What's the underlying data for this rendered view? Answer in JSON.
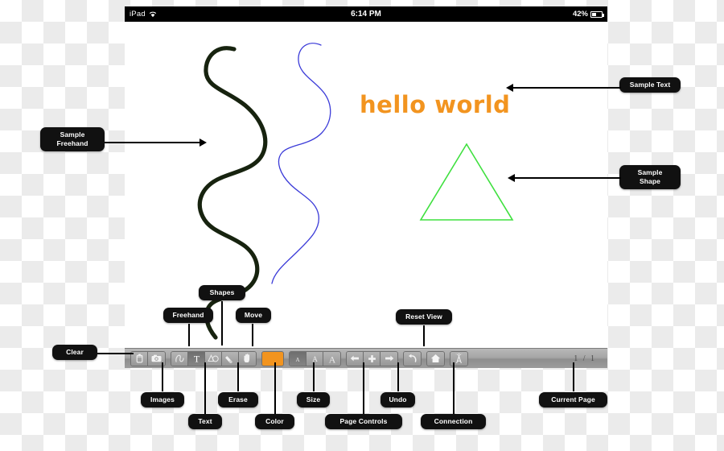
{
  "device": {
    "status_bar": {
      "device_name": "iPad",
      "wifi_icon": "wifi-icon",
      "time": "6:14 PM",
      "battery_percent": "42%",
      "battery_icon": "battery-icon"
    }
  },
  "canvas": {
    "text_object": "hello world",
    "text_color": "#f2941f",
    "freehand_stroke_1_color": "#17230f",
    "freehand_stroke_2_color": "#3b3bd8",
    "shape": "triangle",
    "shape_color": "#3fe03f"
  },
  "toolbar": {
    "groups": [
      {
        "name": "file-group",
        "buttons": [
          {
            "name": "clear-button",
            "icon": "trash-icon",
            "selected": false
          },
          {
            "name": "images-button",
            "icon": "camera-icon",
            "selected": false
          }
        ]
      },
      {
        "name": "tools-group",
        "buttons": [
          {
            "name": "freehand-tool",
            "icon": "squiggle-icon",
            "selected": false
          },
          {
            "name": "text-tool",
            "icon": "text-T-icon",
            "selected": true
          },
          {
            "name": "shapes-tool",
            "icon": "shapes-icon",
            "selected": false
          },
          {
            "name": "erase-tool",
            "icon": "eraser-icon",
            "selected": false
          },
          {
            "name": "move-tool",
            "icon": "hand-icon",
            "selected": false
          }
        ]
      },
      {
        "name": "size-group",
        "buttons": [
          {
            "name": "size-small",
            "icon": "A-small-icon",
            "selected": true
          },
          {
            "name": "size-medium",
            "icon": "A-medium-icon",
            "selected": false
          },
          {
            "name": "size-large",
            "icon": "A-large-icon",
            "selected": false
          }
        ]
      },
      {
        "name": "page-controls-group",
        "buttons": [
          {
            "name": "page-previous",
            "icon": "arrow-left-icon",
            "selected": false
          },
          {
            "name": "page-add",
            "icon": "plus-icon",
            "selected": false
          },
          {
            "name": "page-next",
            "icon": "arrow-right-icon",
            "selected": false
          }
        ]
      },
      {
        "name": "undo-group",
        "buttons": [
          {
            "name": "undo-button",
            "icon": "undo-arrow-icon",
            "selected": false
          }
        ]
      },
      {
        "name": "reset-view-group",
        "buttons": [
          {
            "name": "reset-view-button",
            "icon": "home-icon",
            "selected": false
          }
        ]
      },
      {
        "name": "connection-group",
        "buttons": [
          {
            "name": "connection-button",
            "icon": "antenna-icon",
            "selected": false
          }
        ]
      }
    ],
    "color_swatch": {
      "name": "color-swatch",
      "value": "#f2941f"
    },
    "page_indicator": "1 / 1"
  },
  "annotations": [
    {
      "id": "sample-freehand",
      "label": "Sample\nFreehand"
    },
    {
      "id": "sample-text",
      "label": "Sample Text"
    },
    {
      "id": "sample-shape",
      "label": "Sample\nShape"
    },
    {
      "id": "shapes",
      "label": "Shapes"
    },
    {
      "id": "freehand",
      "label": "Freehand"
    },
    {
      "id": "move",
      "label": "Move"
    },
    {
      "id": "reset-view",
      "label": "Reset View"
    },
    {
      "id": "clear",
      "label": "Clear"
    },
    {
      "id": "images",
      "label": "Images"
    },
    {
      "id": "text",
      "label": "Text"
    },
    {
      "id": "erase",
      "label": "Erase"
    },
    {
      "id": "color",
      "label": "Color"
    },
    {
      "id": "size",
      "label": "Size"
    },
    {
      "id": "page-controls",
      "label": "Page Controls"
    },
    {
      "id": "undo",
      "label": "Undo"
    },
    {
      "id": "connection",
      "label": "Connection"
    },
    {
      "id": "current-page",
      "label": "Current Page"
    }
  ]
}
